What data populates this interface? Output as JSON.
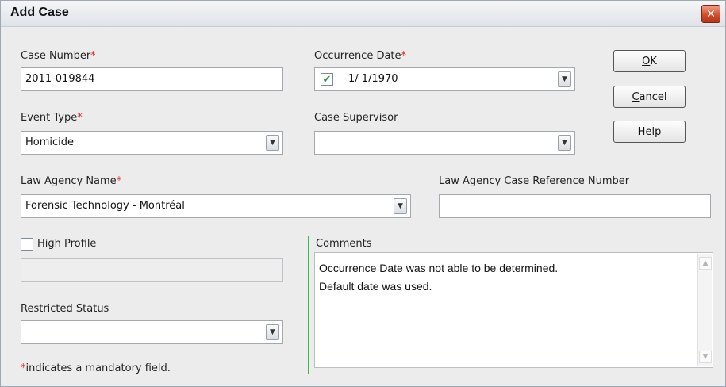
{
  "window": {
    "title": "Add Case",
    "close_glyph": "✕"
  },
  "required_marker": "*",
  "fields": {
    "case_number": {
      "label": "Case Number",
      "value": "2011-019844"
    },
    "occurrence_date": {
      "label": "Occurrence Date",
      "value": "1/ 1/1970",
      "checked": true
    },
    "event_type": {
      "label": "Event Type",
      "value": "Homicide"
    },
    "case_supervisor": {
      "label": "Case Supervisor",
      "value": ""
    },
    "law_agency_name": {
      "label": "Law Agency Name",
      "value": "Forensic Technology - Montréal"
    },
    "law_agency_ref": {
      "label": "Law Agency Case Reference Number",
      "value": ""
    },
    "high_profile": {
      "label": "High Profile",
      "checked": false,
      "value": ""
    },
    "restricted_status": {
      "label": "Restricted Status",
      "value": ""
    },
    "comments": {
      "label": "Comments",
      "value": "Occurrence Date was not able to be determined.\nDefault date was used."
    }
  },
  "buttons": {
    "ok": {
      "mnemonic": "O",
      "rest": "K"
    },
    "cancel": {
      "mnemonic": "C",
      "rest": "ancel"
    },
    "help": {
      "mnemonic": "H",
      "rest": "elp"
    }
  },
  "footer": {
    "text": "indicates a mandatory field."
  },
  "icons": {
    "dropdown": "▼",
    "checkmark": "✔",
    "scroll_up": "▲",
    "scroll_down": "▼"
  },
  "colors": {
    "required": "#e02020",
    "comments_border": "#3dbb4a",
    "checkmark": "#1f9b2e",
    "close_button": "#d24f2e"
  }
}
